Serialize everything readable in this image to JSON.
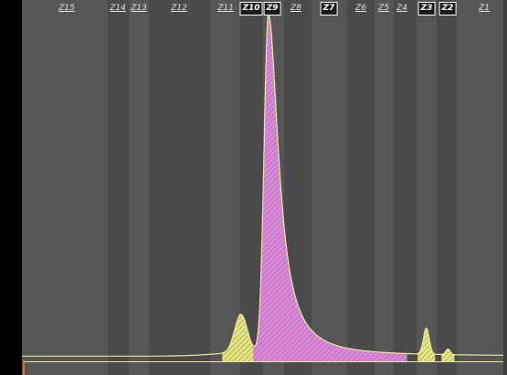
{
  "colors": {
    "background": "#3d3d3d",
    "band_light": "#565656",
    "band_dark": "#4a4a4a",
    "left_strip": "#000000",
    "trace": "#e8e6a0",
    "peak_fill_pink": "#d98ad9",
    "peak_fill_yellow": "#e6e680",
    "baseline": "#e86a2a"
  },
  "zones": [
    {
      "label": "Z15",
      "boxed": false
    },
    {
      "label": "Z14",
      "boxed": false
    },
    {
      "label": "Z13",
      "boxed": false
    },
    {
      "label": "Z12",
      "boxed": false
    },
    {
      "label": "Z11",
      "boxed": false
    },
    {
      "label": "Z10",
      "boxed": true
    },
    {
      "label": "Z9",
      "boxed": true
    },
    {
      "label": "Z8",
      "boxed": false
    },
    {
      "label": "Z7",
      "boxed": true
    },
    {
      "label": "Z6",
      "boxed": false
    },
    {
      "label": "Z5",
      "boxed": false
    },
    {
      "label": "Z4",
      "boxed": false
    },
    {
      "label": "Z3",
      "boxed": true
    },
    {
      "label": "Z2",
      "boxed": true
    },
    {
      "label": "Z1",
      "boxed": false
    }
  ],
  "chart_data": {
    "type": "area",
    "title": "",
    "xlabel": "",
    "ylabel": "",
    "xlim": [
      0,
      100
    ],
    "ylim": [
      0,
      100
    ],
    "grid": false,
    "baseline_level": 1.5,
    "peaks": [
      {
        "zone": "Z10",
        "center": 45.5,
        "height": 11,
        "sigma": 1.3,
        "fill": "yellow"
      },
      {
        "zone": "Z9",
        "center": 51.2,
        "height": 98,
        "sigma_left": 0.9,
        "tail_right": 3.2,
        "fill": "pink"
      },
      {
        "zone": "Z3",
        "center": 84.0,
        "height": 7.5,
        "sigma": 0.6,
        "fill": "yellow"
      },
      {
        "zone": "Z2",
        "center": 88.5,
        "height": 1.6,
        "sigma": 0.45,
        "fill": "yellow"
      }
    ]
  }
}
